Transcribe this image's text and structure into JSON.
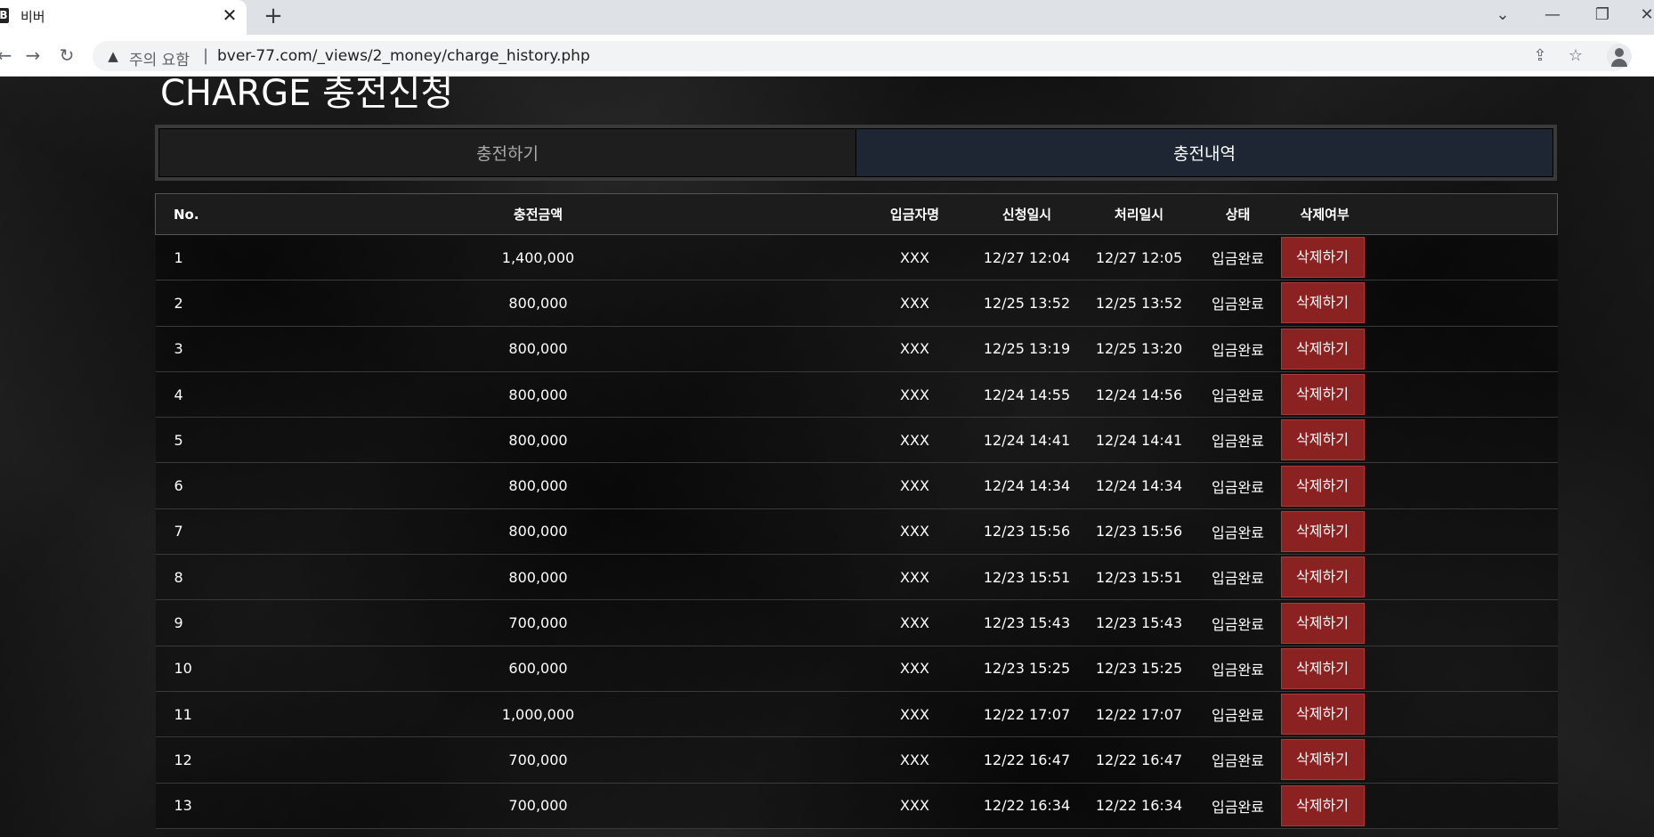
{
  "browser": {
    "tab_title": "비버",
    "favicon_letter": "B",
    "security_label": "주의 요함",
    "url": "bver-77.com/_views/2_money/charge_history.php"
  },
  "page": {
    "title": "CHARGE 충전신청",
    "tabs": [
      {
        "label": "충전하기",
        "active": false
      },
      {
        "label": "충전내역",
        "active": true
      }
    ]
  },
  "table": {
    "headers": {
      "no": "No.",
      "amount": "충전금액",
      "depositor": "입금자명",
      "request_time": "신청일시",
      "process_time": "처리일시",
      "status": "상태",
      "delete": "삭제여부"
    },
    "delete_label": "삭제하기",
    "rows": [
      {
        "no": "1",
        "amount": "1,400,000",
        "depositor": "XXX",
        "request_time": "12/27 12:04",
        "process_time": "12/27 12:05",
        "status": "입금완료"
      },
      {
        "no": "2",
        "amount": "800,000",
        "depositor": "XXX",
        "request_time": "12/25 13:52",
        "process_time": "12/25 13:52",
        "status": "입금완료"
      },
      {
        "no": "3",
        "amount": "800,000",
        "depositor": "XXX",
        "request_time": "12/25 13:19",
        "process_time": "12/25 13:20",
        "status": "입금완료"
      },
      {
        "no": "4",
        "amount": "800,000",
        "depositor": "XXX",
        "request_time": "12/24 14:55",
        "process_time": "12/24 14:56",
        "status": "입금완료"
      },
      {
        "no": "5",
        "amount": "800,000",
        "depositor": "XXX",
        "request_time": "12/24 14:41",
        "process_time": "12/24 14:41",
        "status": "입금완료"
      },
      {
        "no": "6",
        "amount": "800,000",
        "depositor": "XXX",
        "request_time": "12/24 14:34",
        "process_time": "12/24 14:34",
        "status": "입금완료"
      },
      {
        "no": "7",
        "amount": "800,000",
        "depositor": "XXX",
        "request_time": "12/23 15:56",
        "process_time": "12/23 15:56",
        "status": "입금완료"
      },
      {
        "no": "8",
        "amount": "800,000",
        "depositor": "XXX",
        "request_time": "12/23 15:51",
        "process_time": "12/23 15:51",
        "status": "입금완료"
      },
      {
        "no": "9",
        "amount": "700,000",
        "depositor": "XXX",
        "request_time": "12/23 15:43",
        "process_time": "12/23 15:43",
        "status": "입금완료"
      },
      {
        "no": "10",
        "amount": "600,000",
        "depositor": "XXX",
        "request_time": "12/23 15:25",
        "process_time": "12/23 15:25",
        "status": "입금완료"
      },
      {
        "no": "11",
        "amount": "1,000,000",
        "depositor": "XXX",
        "request_time": "12/22 17:07",
        "process_time": "12/22 17:07",
        "status": "입금완료"
      },
      {
        "no": "12",
        "amount": "700,000",
        "depositor": "XXX",
        "request_time": "12/22 16:47",
        "process_time": "12/22 16:47",
        "status": "입금완료"
      },
      {
        "no": "13",
        "amount": "700,000",
        "depositor": "XXX",
        "request_time": "12/22 16:34",
        "process_time": "12/22 16:34",
        "status": "입금완료"
      }
    ]
  },
  "colors": {
    "delete_button": "#8b2222",
    "active_tab": "#1e2633"
  }
}
